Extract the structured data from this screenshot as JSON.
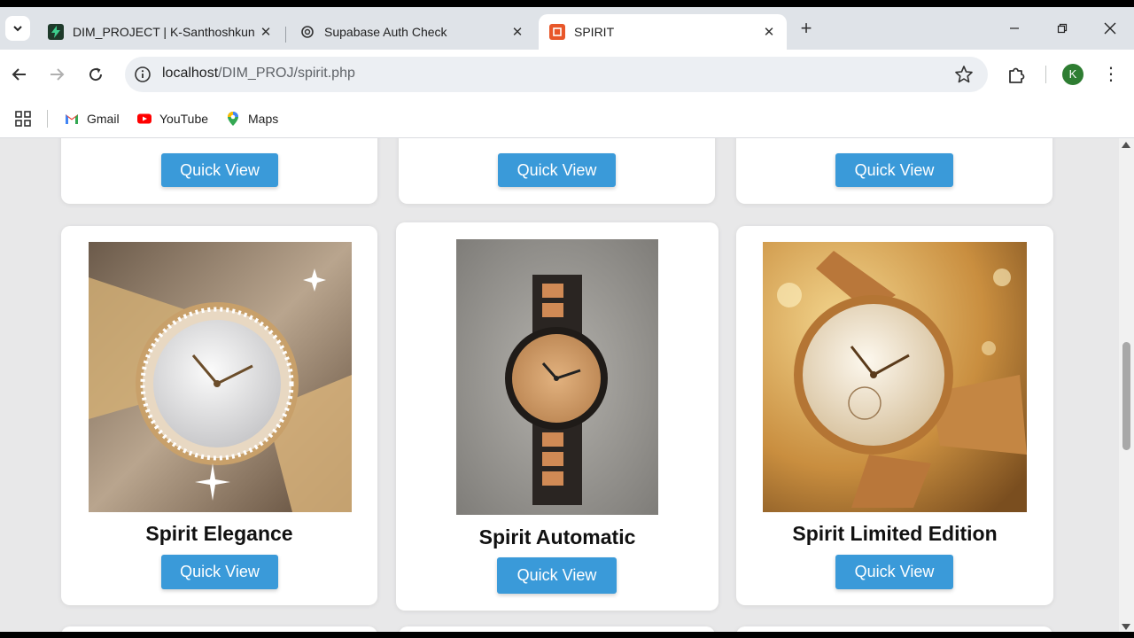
{
  "browser": {
    "tabs": [
      {
        "title": "DIM_PROJECT | K-Santhoshkun",
        "favicon": "green-bolt-icon"
      },
      {
        "title": "Supabase Auth Check",
        "favicon": "openai-icon"
      },
      {
        "title": "SPIRIT",
        "favicon": "spirit-logo-icon",
        "active": true
      }
    ],
    "address": {
      "host": "localhost",
      "path": "/DIM_PROJ/spirit.php"
    },
    "profile_initial": "K",
    "bookmarks": [
      {
        "label": "Gmail",
        "icon": "gmail-icon"
      },
      {
        "label": "YouTube",
        "icon": "youtube-icon"
      },
      {
        "label": "Maps",
        "icon": "maps-icon"
      }
    ],
    "colors": {
      "accent": "#3a9ad9",
      "chrome": "#dfe3e8",
      "page": "#e8e8e9"
    }
  },
  "products": {
    "top_row": [
      {
        "button": "Quick View"
      },
      {
        "button": "Quick View"
      },
      {
        "button": "Quick View"
      }
    ],
    "main_row": [
      {
        "name": "Spirit Elegance",
        "button": "Quick View",
        "image": "gold-diamond-watch"
      },
      {
        "name": "Spirit Automatic",
        "button": "Quick View",
        "image": "wooden-watch"
      },
      {
        "name": "Spirit Limited Edition",
        "button": "Quick View",
        "image": "rose-gold-watch"
      }
    ]
  }
}
